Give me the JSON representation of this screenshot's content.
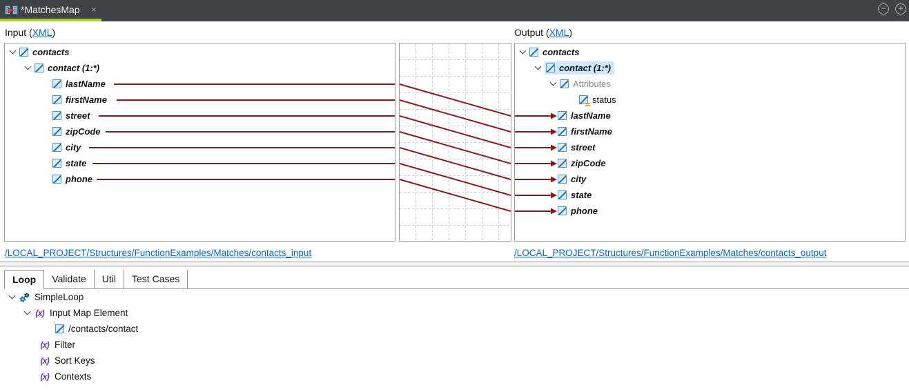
{
  "editor": {
    "tab_title": "*MatchesMap",
    "close_glyph": "×",
    "zoom_out_glyph": "−",
    "zoom_in_glyph": "+"
  },
  "panes": {
    "input_header_prefix": "Input (",
    "output_header_prefix": "Output (",
    "header_link": "XML",
    "header_suffix": ")",
    "input_path_link": "/LOCAL_PROJECT/Structures/FunctionExamples/Matches/contacts_input",
    "output_path_link": "/LOCAL_PROJECT/Structures/FunctionExamples/Matches/contacts_output"
  },
  "input_tree": {
    "items": [
      {
        "label": "contacts"
      },
      {
        "label": "contact (1:*)"
      },
      {
        "label": "lastName"
      },
      {
        "label": "firstName"
      },
      {
        "label": "street"
      },
      {
        "label": "zipCode"
      },
      {
        "label": "city"
      },
      {
        "label": "state"
      },
      {
        "label": "phone"
      }
    ]
  },
  "output_tree": {
    "items": [
      {
        "label": "contacts"
      },
      {
        "label": "contact (1:*)",
        "selected": true
      },
      {
        "label": "Attributes",
        "muted": true
      },
      {
        "label": "status",
        "attribute": true
      },
      {
        "label": "lastName"
      },
      {
        "label": "firstName"
      },
      {
        "label": "street"
      },
      {
        "label": "zipCode"
      },
      {
        "label": "city"
      },
      {
        "label": "state"
      },
      {
        "label": "phone"
      }
    ]
  },
  "mappings": [
    {
      "from": "lastName",
      "to": "lastName"
    },
    {
      "from": "firstName",
      "to": "firstName"
    },
    {
      "from": "street",
      "to": "street"
    },
    {
      "from": "zipCode",
      "to": "zipCode"
    },
    {
      "from": "city",
      "to": "city"
    },
    {
      "from": "state",
      "to": "state"
    },
    {
      "from": "phone",
      "to": "phone"
    }
  ],
  "bottom_panel": {
    "tabs": [
      {
        "label": "Loop",
        "active": true
      },
      {
        "label": "Validate"
      },
      {
        "label": "Util"
      },
      {
        "label": "Test Cases"
      }
    ],
    "tree": [
      {
        "label": "SimpleLoop"
      },
      {
        "label": "Input Map Element"
      },
      {
        "label": "/contacts/contact"
      },
      {
        "label": "Filter"
      },
      {
        "label": "Sort Keys"
      },
      {
        "label": "Contexts"
      }
    ]
  },
  "colors": {
    "tabbar_bg": "#3e4347",
    "active_tab_accent": "#b2ca2f",
    "mapping_line": "#8b1717",
    "link_blue": "#0563c1",
    "selection_blue": "#cde8ff"
  }
}
